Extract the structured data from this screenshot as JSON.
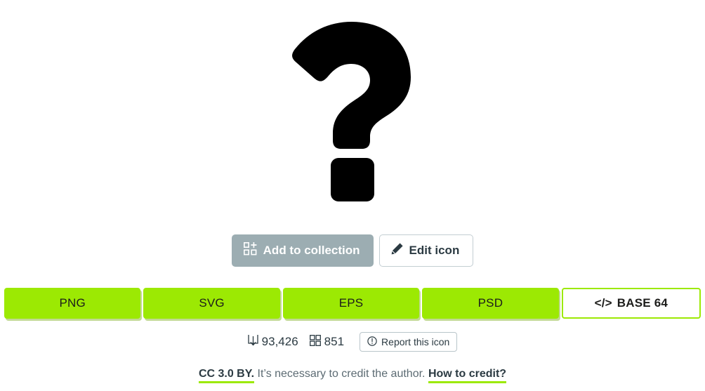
{
  "preview": {
    "icon_name": "question-mark-icon",
    "icon_color": "#000000"
  },
  "actions": {
    "add_to_collection_label": "Add to collection",
    "add_to_collection_icon": "grid-plus-icon",
    "add_to_collection_bg": "#9CADB2",
    "edit_icon_label": "Edit icon",
    "edit_icon_icon": "pencil-icon"
  },
  "formats": {
    "accent": "#9CE903",
    "items": [
      {
        "label": "PNG",
        "style": "solid"
      },
      {
        "label": "SVG",
        "style": "solid"
      },
      {
        "label": "EPS",
        "style": "solid"
      },
      {
        "label": "PSD",
        "style": "solid"
      },
      {
        "label": "BASE 64",
        "prefix": "</>",
        "style": "outline"
      }
    ]
  },
  "stats": {
    "downloads_icon": "download-icon",
    "downloads": "93,426",
    "collections_icon": "grid-icon",
    "collections": "851",
    "report_icon": "alert-circle-icon",
    "report_label": "Report this icon"
  },
  "license": {
    "name": "CC 3.0 BY.",
    "description": "It’s necessary to credit the author.",
    "how_to_credit": "How to credit?"
  }
}
